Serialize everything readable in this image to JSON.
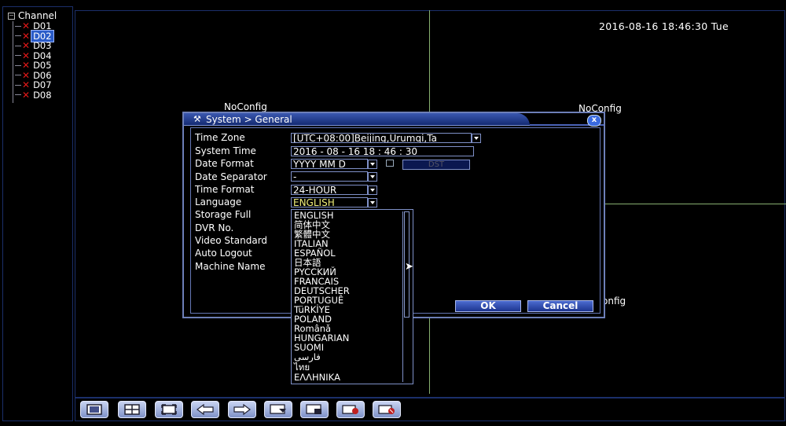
{
  "sidebar": {
    "root_label": "Channel",
    "channels": [
      {
        "label": "D01",
        "selected": false
      },
      {
        "label": "D02",
        "selected": true
      },
      {
        "label": "D03",
        "selected": false
      },
      {
        "label": "D04",
        "selected": false
      },
      {
        "label": "D05",
        "selected": false
      },
      {
        "label": "D06",
        "selected": false
      },
      {
        "label": "D07",
        "selected": false
      },
      {
        "label": "D08",
        "selected": false
      }
    ]
  },
  "screen": {
    "datetime": "2016-08-16 18:46:30 Tue",
    "noconfig_1": "NoConfig",
    "noconfig_2": "NoConfig",
    "noconfig_3": "onfig",
    "grid_line_color": "#88b070"
  },
  "dialog": {
    "title": "System > General",
    "close_label": "x",
    "labels": {
      "time_zone": "Time Zone",
      "system_time": "System Time",
      "date_format": "Date Format",
      "date_separator": "Date Separator",
      "time_format": "Time Format",
      "language": "Language",
      "storage_full": "Storage Full",
      "dvr_no": "DVR No.",
      "video_standard": "Video Standard",
      "auto_logout": "Auto Logout",
      "machine_name": "Machine Name"
    },
    "values": {
      "time_zone": "[UTC+08:00]Beijing,Urumqi,Ta",
      "system_time": "2016 - 08 - 16   18 : 46 : 30",
      "date_format": "YYYY MM D",
      "date_separator": "-",
      "time_format": "24-HOUR",
      "language": "ENGLISH"
    },
    "dst_label": "DST",
    "ok_label": "OK",
    "cancel_label": "Cancel",
    "language_options": [
      "ENGLISH",
      "简体中文",
      "繁體中文",
      "ITALIAN",
      "ESPAÑOL",
      "日本語",
      "PYCCKИЙ",
      "FRANCAIS",
      "DEUTSCHER",
      "PORTUGUÊ",
      "TüRKİYE",
      "POLAND",
      "Românǎ",
      "HUNGARIAN",
      "SUOMI",
      "فارسی",
      "ไทย",
      "ΕΛΛΗΝΙΚΑ"
    ]
  },
  "toolbar": {
    "icons": [
      "single-view-icon",
      "quad-view-icon",
      "fullscreen-icon",
      "previous-arrow-icon",
      "next-arrow-icon",
      "playback-icon",
      "record-icon",
      "alarm-icon",
      "network-icon"
    ]
  },
  "colors": {
    "accent_blue": "#2b5cc8",
    "border_blue": "#7f90c8",
    "channel_x_red": "#e01818"
  }
}
